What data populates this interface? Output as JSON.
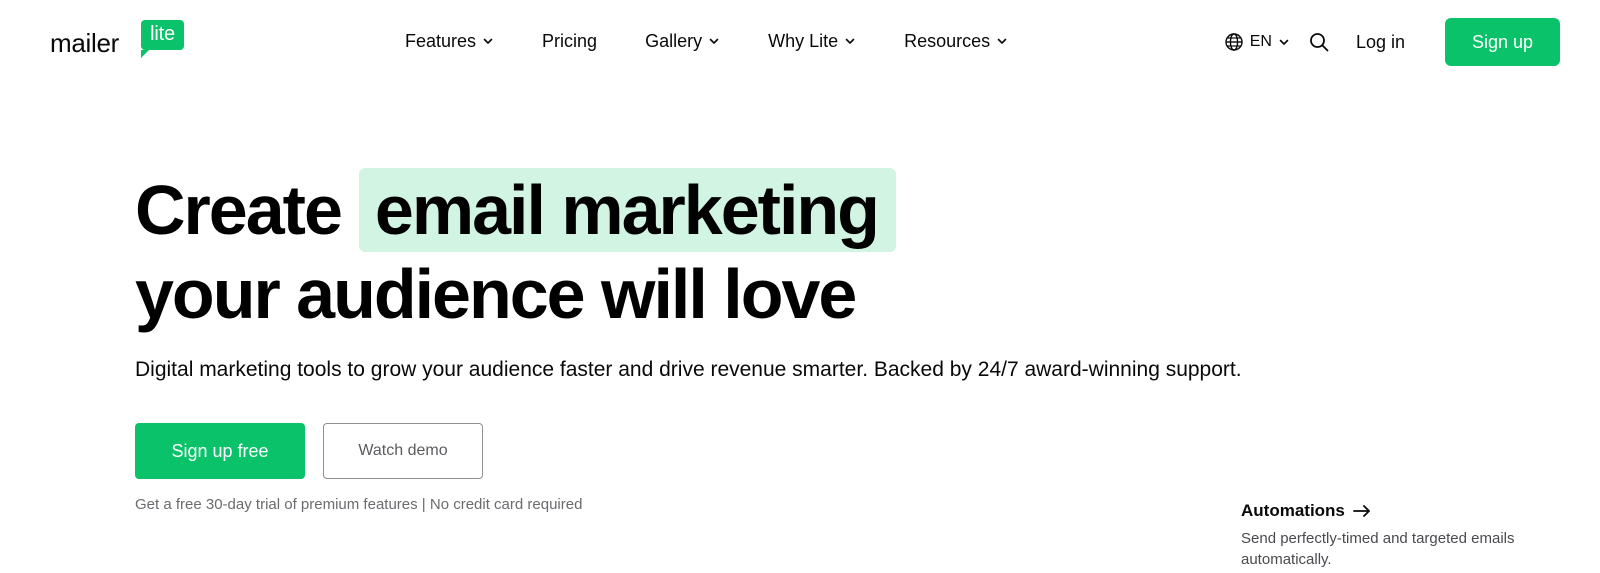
{
  "brand": {
    "word": "mailer",
    "badge": "lite",
    "accent_color": "#09c269",
    "highlight_color": "#d2f4e2"
  },
  "nav": {
    "items": [
      {
        "label": "Features",
        "has_dropdown": true
      },
      {
        "label": "Pricing",
        "has_dropdown": false
      },
      {
        "label": "Gallery",
        "has_dropdown": true
      },
      {
        "label": "Why Lite",
        "has_dropdown": true
      },
      {
        "label": "Resources",
        "has_dropdown": true
      }
    ]
  },
  "header": {
    "language": "EN",
    "language_icon": "globe-icon",
    "search_icon": "search-icon",
    "login_label": "Log in",
    "signup_label": "Sign up"
  },
  "hero": {
    "headline_prefix": "Create",
    "headline_highlight": "email marketing",
    "headline_line2": "your audience will love",
    "subheadline": "Digital marketing tools to grow your audience faster and drive revenue smarter. Backed by 24/7 award-winning support.",
    "primary_cta": "Sign up free",
    "secondary_cta": "Watch demo",
    "fineprint": "Get a free 30-day trial of premium features | No credit card required"
  },
  "feature": {
    "title": "Automations",
    "arrow_icon": "arrow-right-icon",
    "description": "Send perfectly-timed and targeted emails automatically."
  }
}
